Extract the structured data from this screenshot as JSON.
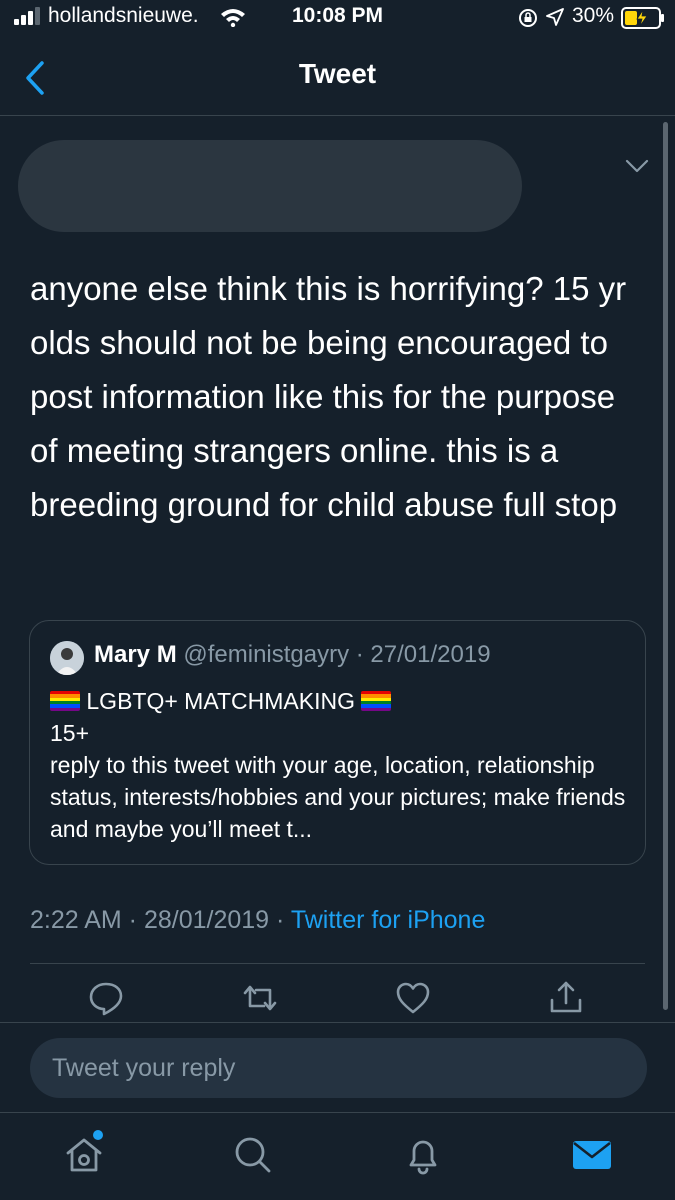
{
  "status_bar": {
    "carrier": "hollandsnieuwe.",
    "time": "10:08 PM",
    "battery_percent": "30%"
  },
  "header": {
    "title": "Tweet"
  },
  "tweet": {
    "text": "anyone else think this is horrifying? 15 yr olds should not be being encouraged to post information like this for the purpose of meeting strangers online. this is a breeding ground for child abuse full stop",
    "timestamp": "2:22 AM · 28/01/2019 · ",
    "source": "Twitter for iPhone"
  },
  "quoted_tweet": {
    "name": "Mary M",
    "handle_date": "@feministgayry · 27/01/2019",
    "title": " LGBTQ+ MATCHMAKING ",
    "age_line": "15+",
    "body": "reply to this tweet with your age, location, relationship status, interests/hobbies and your pictures; make friends and maybe you’ll meet t..."
  },
  "reply": {
    "placeholder": "Tweet your reply"
  },
  "icons": {
    "back": "chevron-left-icon",
    "caret": "chevron-down-icon",
    "actions": [
      "reply-icon",
      "retweet-icon",
      "like-icon",
      "share-icon"
    ],
    "tabs": [
      "home-icon",
      "search-icon",
      "notifications-icon",
      "messages-icon"
    ]
  },
  "colors": {
    "background": "#15202b",
    "accent": "#1da1f2",
    "muted_text": "#8899a6",
    "border": "#38444d"
  }
}
